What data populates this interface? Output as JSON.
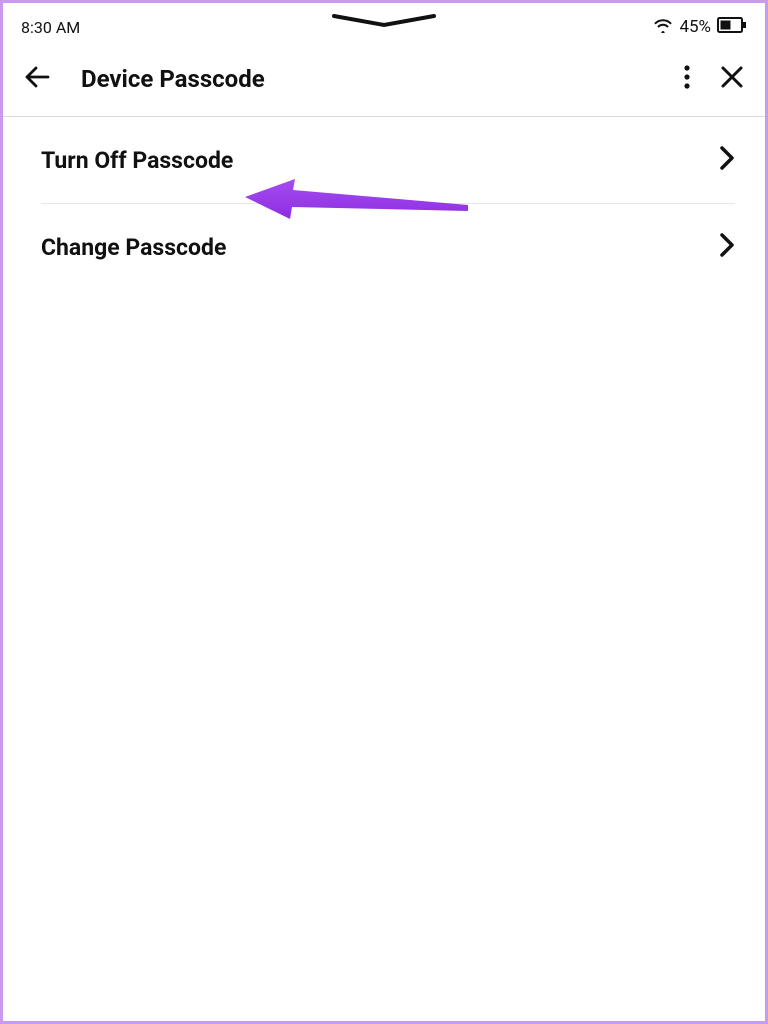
{
  "status": {
    "time": "8:30 AM",
    "battery": "45%"
  },
  "header": {
    "title": "Device Passcode"
  },
  "list": {
    "items": [
      {
        "label": "Turn Off Passcode"
      },
      {
        "label": "Change Passcode"
      }
    ]
  },
  "annotation": {
    "color": "#9b3ce8"
  }
}
